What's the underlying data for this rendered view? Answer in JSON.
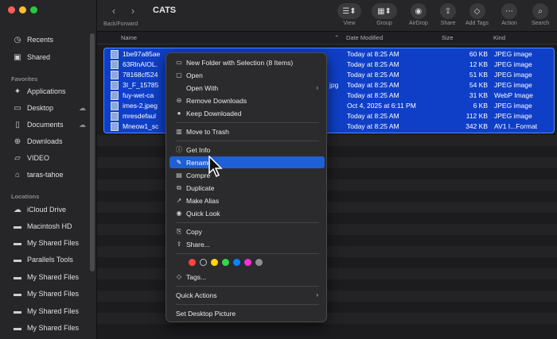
{
  "window": {
    "title": "CATS",
    "back_forward_label": "Back/Forward"
  },
  "traffic_lights": [
    "#ff5f57",
    "#febc2e",
    "#28c840"
  ],
  "sidebar": {
    "recents": "Recents",
    "shared": "Shared",
    "favorites_header": "Favorites",
    "favorites": [
      "Applications",
      "Desktop",
      "Documents",
      "Downloads",
      "VIDEO",
      "taras-tahoe"
    ],
    "locations_header": "Locations",
    "locations": [
      "iCloud Drive",
      "Macintosh HD",
      "My Shared Files",
      "Parallels Tools",
      "My Shared Files",
      "My Shared Files",
      "My Shared Files",
      "My Shared Files"
    ]
  },
  "toolbar": {
    "view": "View",
    "group": "Group",
    "airdrop": "AirDrop",
    "share": "Share",
    "add_tags": "Add Tags",
    "action": "Action",
    "search": "Search"
  },
  "columns": {
    "name": "Name",
    "date_modified": "Date Modified",
    "size": "Size",
    "kind": "Kind"
  },
  "files": [
    {
      "name": "1be97a85ae",
      "date": "Today at 8:25 AM",
      "size": "60 KB",
      "kind": "JPEG image"
    },
    {
      "name": "63RlnAIOL.",
      "date": "Today at 8:25 AM",
      "size": "12 KB",
      "kind": "JPEG image"
    },
    {
      "name": "78168cf524",
      "date": "Today at 8:25 AM",
      "size": "51 KB",
      "kind": "JPEG image"
    },
    {
      "name": "3I_F_15785",
      "name_suffix": "jpg",
      "date": "Today at 8:25 AM",
      "size": "54 KB",
      "kind": "JPEG image"
    },
    {
      "name": "fuy-wet-ca",
      "date": "Today at 8:25 AM",
      "size": "31 KB",
      "kind": "WebP Image"
    },
    {
      "name": "imes-2.jpeg",
      "date": "Oct 4, 2025 at 6:11 PM",
      "size": "6 KB",
      "kind": "JPEG image"
    },
    {
      "name": "mresdefaul",
      "date": "Today at 8:25 AM",
      "size": "112 KB",
      "kind": "JPEG image"
    },
    {
      "name": "Mneow1_sc",
      "date": "Today at 8:25 AM",
      "size": "342 KB",
      "kind": "AV1 I...Format"
    }
  ],
  "context_menu": {
    "new_folder": "New Folder with Selection (8 Items)",
    "open": "Open",
    "open_with": "Open With",
    "remove_downloads": "Remove Downloads",
    "keep_downloaded": "Keep Downloaded",
    "move_to_trash": "Move to Trash",
    "get_info": "Get Info",
    "rename": "Rename",
    "compress": "Compre",
    "duplicate": "Duplicate",
    "make_alias": "Make Alias",
    "quick_look": "Quick Look",
    "copy": "Copy",
    "share": "Share...",
    "tags": "Tags...",
    "quick_actions": "Quick Actions",
    "set_desktop_picture": "Set Desktop Picture",
    "tag_colors": [
      "#ff453a",
      "#3a3a3c",
      "#ffd60a",
      "#32d74b",
      "#0a84ff",
      "#ff2fd6",
      "#8e8e93"
    ]
  }
}
